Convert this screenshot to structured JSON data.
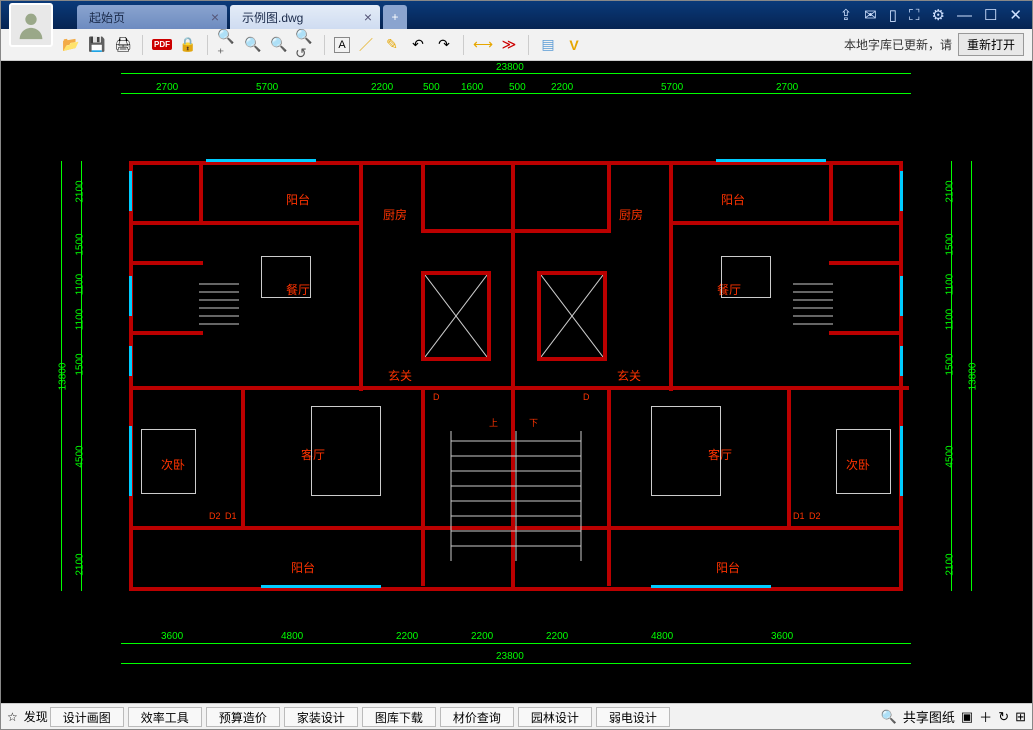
{
  "tabs": {
    "t1": "起始页",
    "t2": "示例图.dwg"
  },
  "status": {
    "msg": "本地字库已更新，请",
    "btn": "重新打开"
  },
  "dims": {
    "top_total": "23800",
    "top_parts": [
      "2700",
      "5700",
      "2200",
      "500",
      "1600",
      "500",
      "2200",
      "5700",
      "2700"
    ],
    "left_total": "13800",
    "left_parts": [
      "2100",
      "1500",
      "1100",
      "1100",
      "1500",
      "4500",
      "2100"
    ],
    "right_total": "13800",
    "right_parts": [
      "2100",
      "1500",
      "1100",
      "1100",
      "1500",
      "4500",
      "2100"
    ],
    "bottom_parts": [
      "3600",
      "4800",
      "2200",
      "2200",
      "2200",
      "4800",
      "3600"
    ],
    "bottom_total": "23800"
  },
  "rooms": {
    "balcony": "阳台",
    "kitchen": "厨房",
    "dining": "餐厅",
    "foyer": "玄关",
    "living": "客厅",
    "bed2": "次卧",
    "up": "上",
    "down": "下",
    "d": "D",
    "d1": "D1",
    "d2": "D2"
  },
  "bottom": {
    "discover": "发现",
    "items": [
      "设计画图",
      "效率工具",
      "预算造价",
      "家装设计",
      "图库下载",
      "材价查询",
      "园林设计",
      "弱电设计"
    ],
    "share": "共享图纸"
  }
}
